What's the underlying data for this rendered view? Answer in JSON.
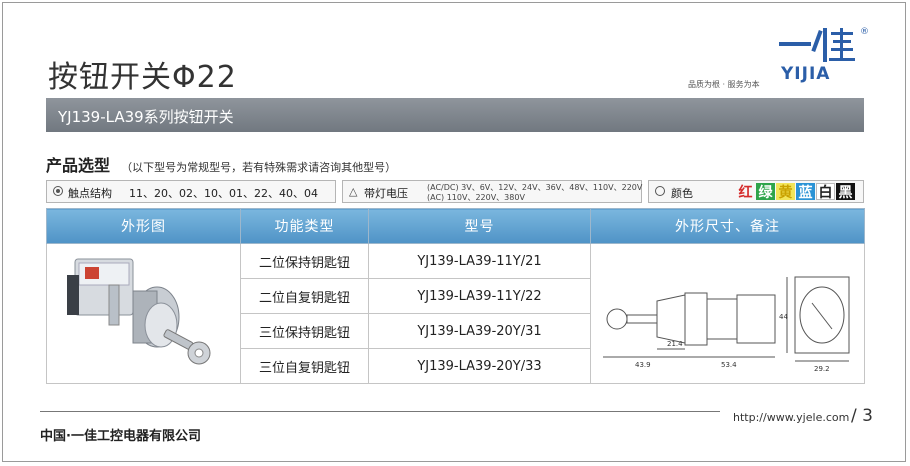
{
  "header": {
    "title": "按钮开关Φ22",
    "logo": {
      "mark": "一佳",
      "text": "YIJIA",
      "reg": "®"
    },
    "slogan": "品质为根 · 服务为本"
  },
  "banner": {
    "series": "YJ139-LA39系列按钮开关"
  },
  "section": {
    "title": "产品选型",
    "note": "（以下型号为常规型号，若有特殊需求请咨询其他型号）"
  },
  "filters": {
    "contact": {
      "label": "触点结构",
      "value": "11、20、02、10、01、22、40、04"
    },
    "lamp": {
      "label": "带灯电压",
      "line1": "(AC/DC) 3V、6V、12V、24V、36V、48V、110V、220V",
      "line2": "(AC) 110V、220V、380V"
    },
    "color": {
      "label": "颜色",
      "options": [
        "红",
        "绿",
        "黄",
        "蓝",
        "白",
        "黑"
      ],
      "option_colors": [
        "#d52b2b",
        "#2ea44a",
        "#f2e55a",
        "#2a93d5",
        "#ffffff",
        "#111111"
      ]
    }
  },
  "table": {
    "headers": [
      "外形图",
      "功能类型",
      "型号",
      "外形尺寸、备注"
    ],
    "rows": [
      {
        "function": "二位保持钥匙钮",
        "model": "YJ139-LA39-11Y/21"
      },
      {
        "function": "二位自复钥匙钮",
        "model": "YJ139-LA39-11Y/22"
      },
      {
        "function": "三位保持钥匙钮",
        "model": "YJ139-LA39-20Y/31"
      },
      {
        "function": "三位自复钥匙钮",
        "model": "YJ139-LA39-20Y/33"
      }
    ],
    "dimensions": {
      "d1": "21.4",
      "d2": "43.9",
      "d3": "53.4",
      "d4": "29.2",
      "d5": "44"
    }
  },
  "footer": {
    "company": "中国·一佳工控电器有限公司",
    "url": "http://www.yjele.com",
    "page": "/ 3"
  },
  "colors": {
    "banner": "#7a8189",
    "header_blue": "#5a9dcc",
    "brand_blue": "#2b5ea8"
  }
}
